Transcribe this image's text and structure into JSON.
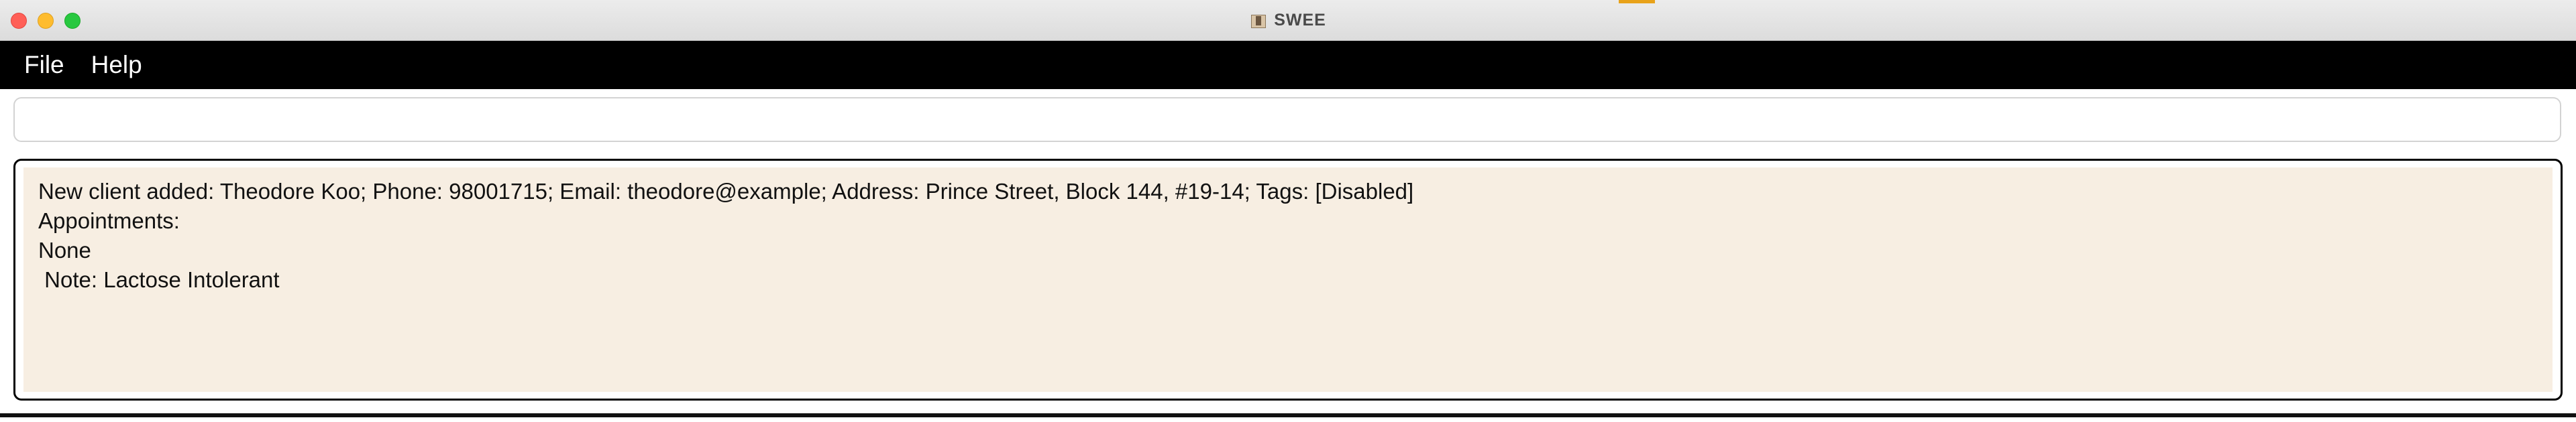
{
  "window": {
    "title": "SWEE",
    "app_icon": "app-jar-icon"
  },
  "menu": {
    "items": [
      {
        "label": "File"
      },
      {
        "label": "Help"
      }
    ]
  },
  "command_box": {
    "value": "",
    "placeholder": ""
  },
  "result_display": {
    "lines": [
      "New client added: Theodore Koo; Phone: 98001715; Email: theodore@example; Address: Prince Street, Block 144, #19-14; Tags: [Disabled]",
      "Appointments:",
      "None",
      " Note: Lactose Intolerant"
    ]
  },
  "colors": {
    "menubar_bg": "#000000",
    "result_bg": "#f7eee2",
    "close": "#ff5f57",
    "minimize": "#febc2e",
    "maximize": "#28c840"
  }
}
